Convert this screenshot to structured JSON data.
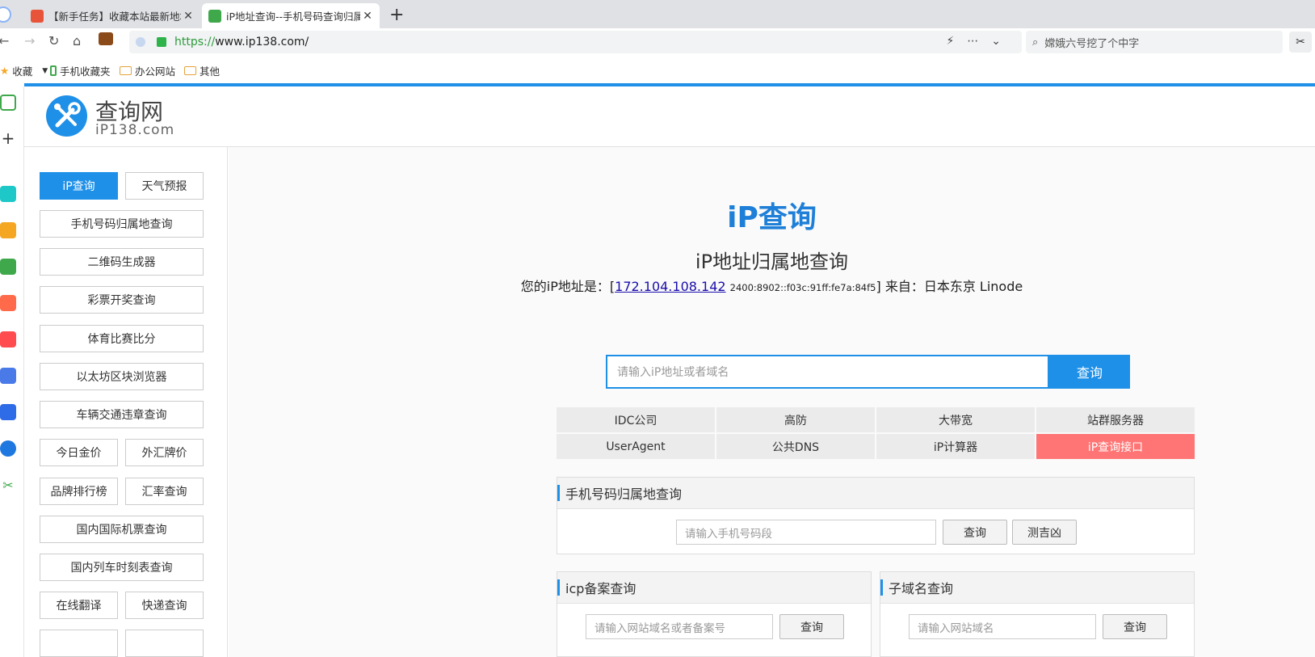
{
  "browser": {
    "tabs": [
      {
        "title": "【新手任务】收藏本站最新地址",
        "close": "✕"
      },
      {
        "title": "iP地址查询--手机号码查询归属地",
        "close": "✕"
      }
    ],
    "new_tab": "+",
    "url_protocol": "https://",
    "url_host": "www.ip138.com/",
    "search_placeholder": "嫦娥六号挖了个中字",
    "bookmarks": [
      "收藏",
      "手机收藏夹",
      "办公网站",
      "其他"
    ]
  },
  "site": {
    "logo_cn": "查询网",
    "logo_en": "iP138.com"
  },
  "sidebar": {
    "row1": [
      "iP查询",
      "天气预报"
    ],
    "full": [
      "手机号码归属地查询",
      "二维码生成器",
      "彩票开奖查询",
      "体育比赛比分",
      "以太坊区块浏览器",
      "车辆交通违章查询"
    ],
    "pairs": [
      [
        "今日金价",
        "外汇牌价"
      ],
      [
        "品牌排行榜",
        "汇率查询"
      ]
    ],
    "full2": [
      "国内国际机票查询",
      "国内列车时刻表查询"
    ],
    "pairs2": [
      [
        "在线翻译",
        "快递查询"
      ]
    ]
  },
  "main": {
    "title": "iP查询",
    "subtitle": "iP地址归属地查询",
    "ip_prefix": "您的iP地址是：[",
    "ip": "172.104.108.142",
    "ipv6": "2400:8902::f03c:91ff:fe7a:84f5",
    "ip_suffix": "] 来自：日本东京 Linode",
    "query_placeholder": "请输入iP地址或者域名",
    "query_button": "查询",
    "links": [
      "IDC公司",
      "高防",
      "大带宽",
      "站群服务器",
      "UserAgent",
      "公共DNS",
      "iP计算器",
      "iP查询接口"
    ],
    "highlight_color": "#ff7575"
  },
  "phone_panel": {
    "title": "手机号码归属地查询",
    "placeholder": "请输入手机号码段",
    "btn_query": "查询",
    "btn_luck": "测吉凶"
  },
  "icp_panel": {
    "title": "icp备案查询",
    "placeholder": "请输入网站域名或者备案号",
    "btn_query": "查询"
  },
  "subdomain_panel": {
    "title": "子域名查询",
    "placeholder": "请输入网站域名",
    "btn_query": "查询"
  }
}
